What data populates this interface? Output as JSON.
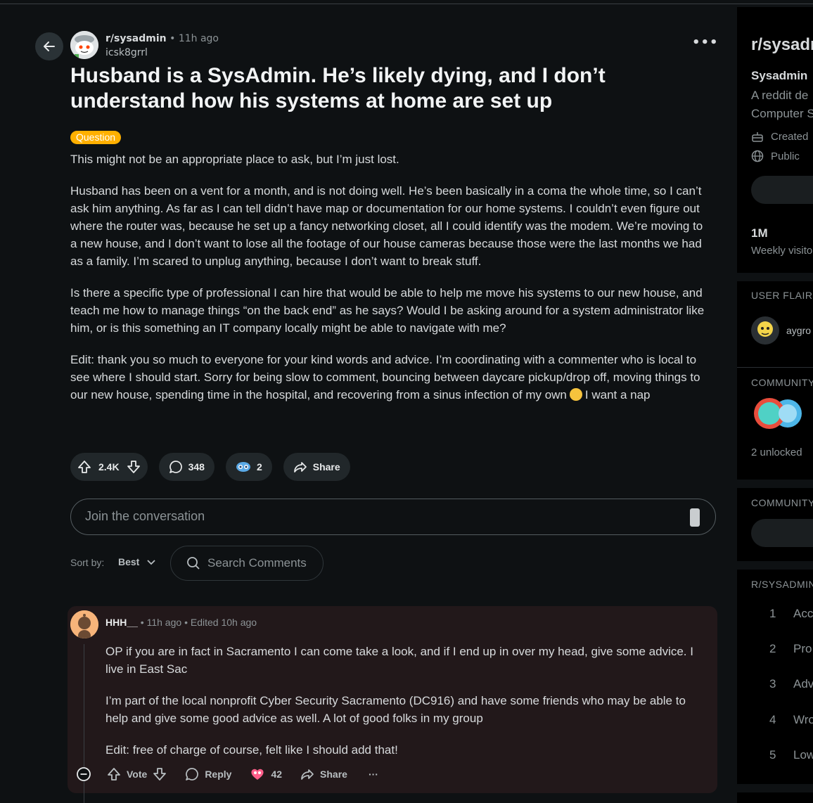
{
  "post": {
    "subreddit": "r/sysadmin",
    "time": "11h ago",
    "separator": "•",
    "author": "icsk8grrl",
    "title": "Husband is a SysAdmin. He’s likely dying, and I don’t understand how his systems at home are set up",
    "flair": "Question",
    "paragraphs": [
      "This might not be an appropriate place to ask, but I’m just lost.",
      "Husband has been on a vent for a month, and is not doing well. He’s been basically in a coma the whole time, so I can’t ask him anything. As far as I can tell didn’t have map or documentation for our home systems. I couldn’t even figure out where the router was, because he set up a fancy networking closet, all I could identify was the modem. We’re moving to a new house, and I don’t want to lose all the footage of our house cameras because those were the last months we had as a family. I’m scared to unplug anything, because I don’t want to break stuff.",
      "Is there a specific type of professional I can hire that would be able to help me move his systems to our new house, and teach me how to manage things “on the back end” as he says? Would I be asking around for a system administrator like him, or is this something an IT company locally might be able to navigate with me?"
    ],
    "edit_text_before": "Edit: thank you so much to everyone for your kind words and advice. I’m coordinating with a commenter who is local to see where I should start. Sorry for being slow to comment, bouncing between daycare pickup/drop off, moving things to our new house, spending time in the hospital, and recovering from a sinus infection of my own",
    "edit_text_after": "I want a nap",
    "votes": "2.4K",
    "comments": "348",
    "awards": "2",
    "share_label": "Share"
  },
  "composer": {
    "placeholder": "Join the conversation"
  },
  "sort": {
    "label": "Sort by:",
    "value": "Best"
  },
  "search": {
    "placeholder": "Search Comments"
  },
  "comment": {
    "username": "HHH__",
    "time": "11h ago",
    "edited": "Edited 10h ago",
    "separator": "•",
    "paragraphs": [
      "OP if you are in fact in Sacramento I can come take a look, and if I end up in over my head, give some advice. I live in East Sac",
      "I’m part of the local nonprofit Cyber Security Sacramento (DC916) and have some friends who may be able to help and give some good advice as well. A lot of good folks in my group",
      "Edit: free of charge of course, felt like I should add that!"
    ],
    "vote_label": "Vote",
    "reply_label": "Reply",
    "awards": "42",
    "share_label": "Share",
    "more": "···"
  },
  "sidebar": {
    "title": "r/sysadm",
    "name": "Sysadmin",
    "desc_line1": "A reddit de",
    "desc_line2": "Computer S",
    "created": "Created",
    "public": "Public",
    "visitors_value": "1M",
    "visitors_label": "Weekly visito",
    "user_flair_heading": "USER FLAIR",
    "flair_user": "aygro",
    "achievements_heading": "COMMUNITY",
    "unlocked": "2 unlocked",
    "community_heading": "COMMUNITY",
    "rules_heading": "R/SYSADMIN",
    "rules": [
      {
        "n": "1",
        "t": "Acc"
      },
      {
        "n": "2",
        "t": "Pro"
      },
      {
        "n": "3",
        "t": "Adv"
      },
      {
        "n": "4",
        "t": "Wro"
      },
      {
        "n": "5",
        "t": "Low"
      }
    ]
  },
  "colors": {
    "background": "#0e1113",
    "flair": "#ffb000",
    "comment_bg": "#22181a",
    "pill": "#21272a"
  }
}
